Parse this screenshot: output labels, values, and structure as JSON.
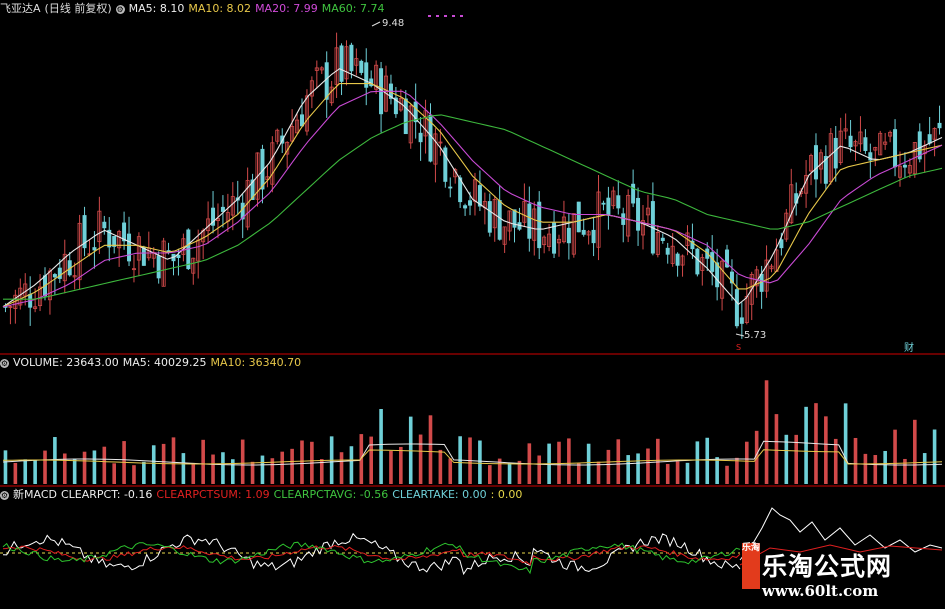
{
  "colors": {
    "up": "#d24a4a",
    "down": "#6fd0d8",
    "ma5": "#e8e8e8",
    "ma10": "#e8c84a",
    "ma20": "#c84ad4",
    "ma60": "#3db83d",
    "sep": "#8b0000",
    "macd_red": "#e02020",
    "macd_green": "#2ec42e",
    "macd_white": "#ffffff",
    "macd_yellow": "#e8d84a"
  },
  "price_panel": {
    "header": {
      "icon": "settings-circle-icon",
      "stock": "飞亚达A",
      "mode": "(日线 前复权)",
      "ma5": "MA5: 8.10",
      "ma10": "MA10: 8.02",
      "ma20": "MA20: 7.99",
      "ma60": "MA60: 7.74"
    },
    "high_label": "9.48",
    "low_label": "5.73",
    "fin_badge": "财",
    "s_badge": "S"
  },
  "volume_panel": {
    "header": {
      "icon": "settings-circle-icon",
      "name": "VOLUME: 23643.00",
      "ma5": "MA5: 40029.25",
      "ma10": "MA10: 36340.70"
    }
  },
  "indicator_panel": {
    "header": {
      "icon": "settings-circle-icon",
      "name": "新MACD",
      "clearpct": "CLEARPCT: -0.16",
      "clearpctsum": "CLEARPCTSUM: 1.09",
      "clearpctavg": "CLEARPCTAVG: -0.56",
      "cleartake": "CLEARTAKE: 0.00",
      "extra": ": 0.00"
    }
  },
  "watermark": {
    "logo": "乐淘",
    "title": "乐淘公式网",
    "url": "www.60lt.com"
  },
  "chart_data": {
    "type": "line",
    "series": [
      {
        "name": "MA5",
        "values": [
          5.9,
          6.2,
          6.6,
          6.9,
          6.7,
          6.5,
          6.9,
          7.3,
          7.8,
          8.6,
          9.0,
          8.8,
          8.5,
          8.0,
          7.3,
          7.0,
          6.9,
          7.0,
          7.1,
          7.0,
          6.8,
          6.4,
          5.9,
          6.6,
          7.6,
          8.0,
          7.8,
          7.9,
          8.1
        ]
      },
      {
        "name": "MA10",
        "values": [
          5.9,
          6.1,
          6.4,
          6.7,
          6.7,
          6.6,
          6.8,
          7.1,
          7.6,
          8.3,
          8.8,
          8.8,
          8.6,
          8.2,
          7.6,
          7.2,
          7.0,
          7.0,
          7.1,
          7.0,
          6.9,
          6.6,
          6.1,
          6.3,
          7.1,
          7.7,
          7.8,
          7.9,
          8.0
        ]
      },
      {
        "name": "MA20",
        "values": [
          5.9,
          6.0,
          6.2,
          6.5,
          6.6,
          6.6,
          6.7,
          7.0,
          7.4,
          8.0,
          8.5,
          8.7,
          8.7,
          8.3,
          7.8,
          7.4,
          7.2,
          7.1,
          7.1,
          7.0,
          6.9,
          6.7,
          6.3,
          6.2,
          6.7,
          7.3,
          7.6,
          7.8,
          8.0
        ]
      },
      {
        "name": "MA60",
        "values": [
          6.0,
          6.0,
          6.1,
          6.2,
          6.3,
          6.4,
          6.5,
          6.7,
          7.0,
          7.4,
          7.8,
          8.1,
          8.3,
          8.4,
          8.3,
          8.2,
          8.0,
          7.8,
          7.6,
          7.4,
          7.3,
          7.1,
          7.0,
          6.9,
          7.0,
          7.2,
          7.4,
          7.6,
          7.7
        ]
      }
    ],
    "ylim": [
      5.6,
      9.6
    ]
  }
}
